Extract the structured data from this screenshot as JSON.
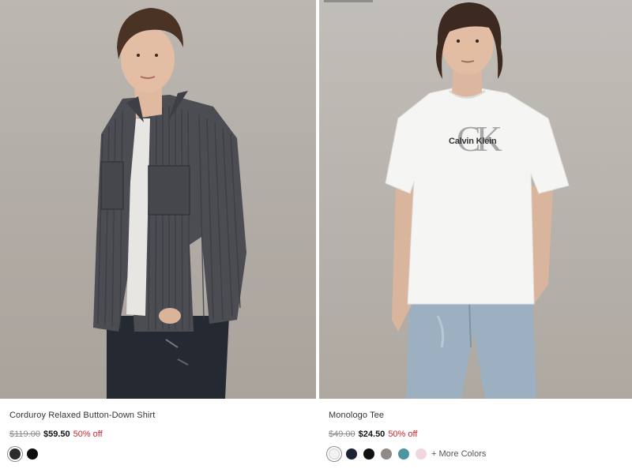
{
  "products": [
    {
      "name": "Corduroy Relaxed Button-Down Shirt",
      "original_price": "$119.00",
      "sale_price": "$59.50",
      "discount": "50% off",
      "swatches": [
        {
          "color": "#2c2b2b",
          "label": "charcoal",
          "selected": true
        },
        {
          "color": "#0e0e0e",
          "label": "black",
          "selected": false
        }
      ]
    },
    {
      "name": "Monologo Tee",
      "original_price": "$49.00",
      "sale_price": "$24.50",
      "discount": "50% off",
      "logo_text": "Calvin Klein",
      "logo_monogram": "CK",
      "swatches": [
        {
          "color": "#f2f2f2",
          "label": "white",
          "selected": true
        },
        {
          "color": "#1c2434",
          "label": "navy",
          "selected": false
        },
        {
          "color": "#111111",
          "label": "black",
          "selected": false
        },
        {
          "color": "#8e8a88",
          "label": "grey",
          "selected": false
        },
        {
          "color": "#4e95a2",
          "label": "teal",
          "selected": false
        },
        {
          "color": "#f1d6dd",
          "label": "pink",
          "selected": false
        }
      ],
      "more_colors": "+ More Colors"
    }
  ],
  "colors": {
    "discount": "#d0232f",
    "strike": "#8a8a8a"
  }
}
